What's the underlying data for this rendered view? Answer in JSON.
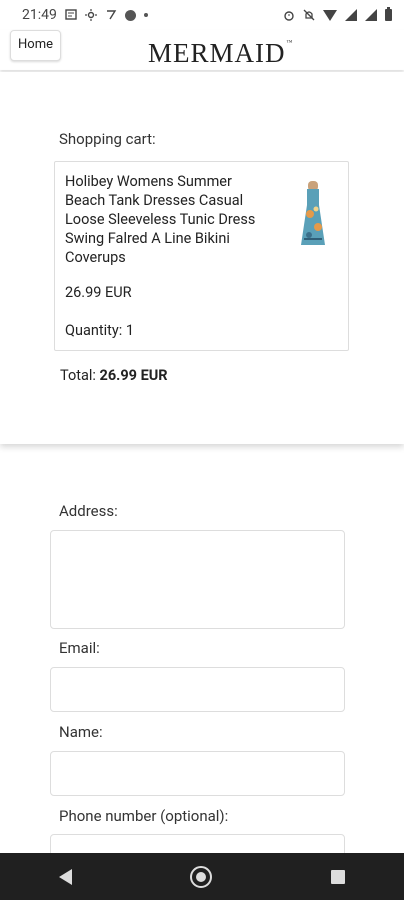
{
  "status_bar": {
    "time": "21:49"
  },
  "header": {
    "home_label": "Home",
    "logo": "MERMAID",
    "logo_tm": "™"
  },
  "cart": {
    "label": "Shopping cart:",
    "item": {
      "title": "Holibey Womens Summer Beach Tank Dresses Casual Loose Sleeveless Tunic Dress Swing Falred A Line Bikini Coverups",
      "price": "26.99 EUR",
      "quantity": "Quantity: 1"
    },
    "total_label": "Total:",
    "total_value": "26.99 EUR"
  },
  "form": {
    "address_label": "Address:",
    "email_label": "Email:",
    "name_label": "Name:",
    "phone_label": "Phone number (optional):"
  },
  "colors": {
    "navbar": "#202020",
    "background": "#ffffff"
  }
}
